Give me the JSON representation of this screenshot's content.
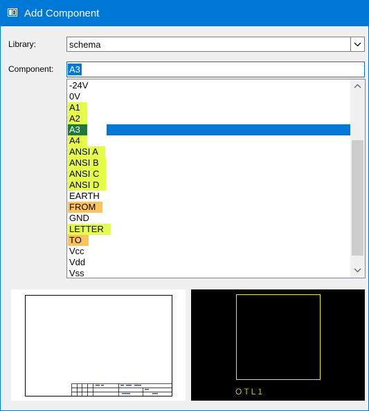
{
  "window": {
    "title": "Add Component",
    "title_icon": "window-app-icon"
  },
  "library": {
    "label": "Library:",
    "value": "schema"
  },
  "component": {
    "label": "Component:",
    "value": "A3"
  },
  "list": {
    "items": [
      {
        "text": "-24V",
        "highlight": "none"
      },
      {
        "text": "0V",
        "highlight": "none"
      },
      {
        "text": "A1",
        "highlight": "yellow"
      },
      {
        "text": "A2",
        "highlight": "yellow"
      },
      {
        "text": "A3",
        "highlight": "selected"
      },
      {
        "text": "A4",
        "highlight": "yellow"
      },
      {
        "text": "ANSI A",
        "highlight": "yellow"
      },
      {
        "text": "ANSI B",
        "highlight": "yellow"
      },
      {
        "text": "ANSI C",
        "highlight": "yellow"
      },
      {
        "text": "ANSI D",
        "highlight": "yellow"
      },
      {
        "text": "EARTH",
        "highlight": "none"
      },
      {
        "text": "FROM",
        "highlight": "orange"
      },
      {
        "text": "GND",
        "highlight": "none"
      },
      {
        "text": "LETTER",
        "highlight": "yellow"
      },
      {
        "text": "TO",
        "highlight": "orange"
      },
      {
        "text": "Vcc",
        "highlight": "none"
      },
      {
        "text": "Vdd",
        "highlight": "none"
      },
      {
        "text": "Vss",
        "highlight": "none"
      }
    ]
  },
  "preview_right": {
    "caption": "OTL1"
  },
  "colors": {
    "accent": "#0078d7",
    "highlight_yellow": "#e6fc4a",
    "highlight_orange": "#f9c45b",
    "selected_item_bg": "#1f7a3a",
    "preview_outline": "#e8e800"
  }
}
